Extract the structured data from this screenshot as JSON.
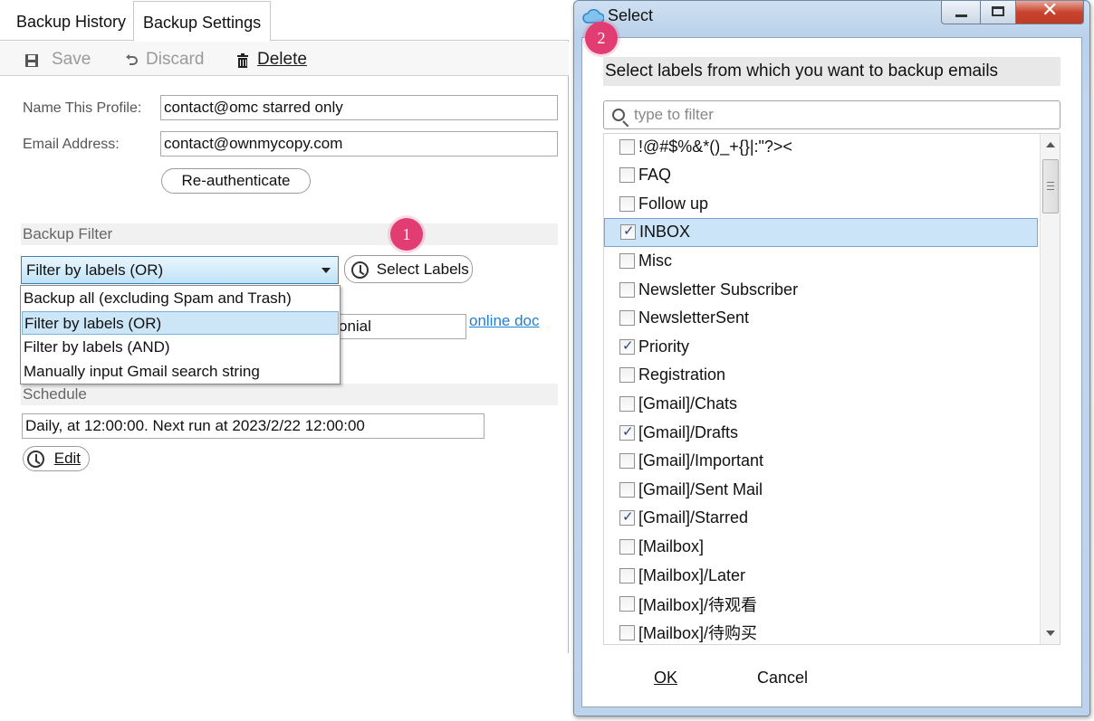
{
  "left": {
    "tabs": [
      {
        "label": "Backup History"
      },
      {
        "label": "Backup Settings"
      }
    ],
    "toolbar": {
      "save": "Save",
      "discard": "Discard",
      "delete": "Delete"
    },
    "form": {
      "name_label": "Name This Profile:",
      "name_value": "contact@omc starred only",
      "email_label": "Email Address:",
      "email_value": "contact@ownmycopy.com",
      "reauth": "Re-authenticate"
    },
    "backup_filter": {
      "heading": "Backup Filter",
      "selected": "Filter by labels (OR)",
      "select_labels": "Select Labels",
      "options": [
        "Backup all (excluding Spam and Trash)",
        "Filter by labels (OR)",
        "Filter by labels (AND)",
        "Manually input Gmail search string"
      ],
      "partial_field": "onial",
      "link": "online doc"
    },
    "schedule": {
      "heading": "Schedule",
      "value": "Daily, at 12:00:00. Next run at 2023/2/22 12:00:00",
      "edit": "Edit"
    },
    "badge": "1"
  },
  "dialog": {
    "title": "Select",
    "badge": "2",
    "heading": "Select labels from which you want to backup emails",
    "filter_placeholder": "type to filter",
    "labels": [
      {
        "name": "!@#$%&*()_+{}|:\"?><",
        "checked": false
      },
      {
        "name": "FAQ",
        "checked": false
      },
      {
        "name": "Follow up",
        "checked": false
      },
      {
        "name": "INBOX",
        "checked": true,
        "selected": true
      },
      {
        "name": "Misc",
        "checked": false
      },
      {
        "name": "Newsletter Subscriber",
        "checked": false
      },
      {
        "name": "NewsletterSent",
        "checked": false
      },
      {
        "name": "Priority",
        "checked": true
      },
      {
        "name": "Registration",
        "checked": false
      },
      {
        "name": "[Gmail]/Chats",
        "checked": false
      },
      {
        "name": "[Gmail]/Drafts",
        "checked": true
      },
      {
        "name": "[Gmail]/Important",
        "checked": false
      },
      {
        "name": "[Gmail]/Sent Mail",
        "checked": false
      },
      {
        "name": "[Gmail]/Starred",
        "checked": true
      },
      {
        "name": "[Mailbox]",
        "checked": false
      },
      {
        "name": "[Mailbox]/Later",
        "checked": false
      },
      {
        "name": "[Mailbox]/待观看",
        "checked": false
      },
      {
        "name": "[Mailbox]/待购买",
        "checked": false
      }
    ],
    "ok": "OK",
    "cancel": "Cancel"
  },
  "colors": {
    "badge": "#e23d73",
    "link": "#1f7fd1",
    "selection": "#cce4f7"
  }
}
